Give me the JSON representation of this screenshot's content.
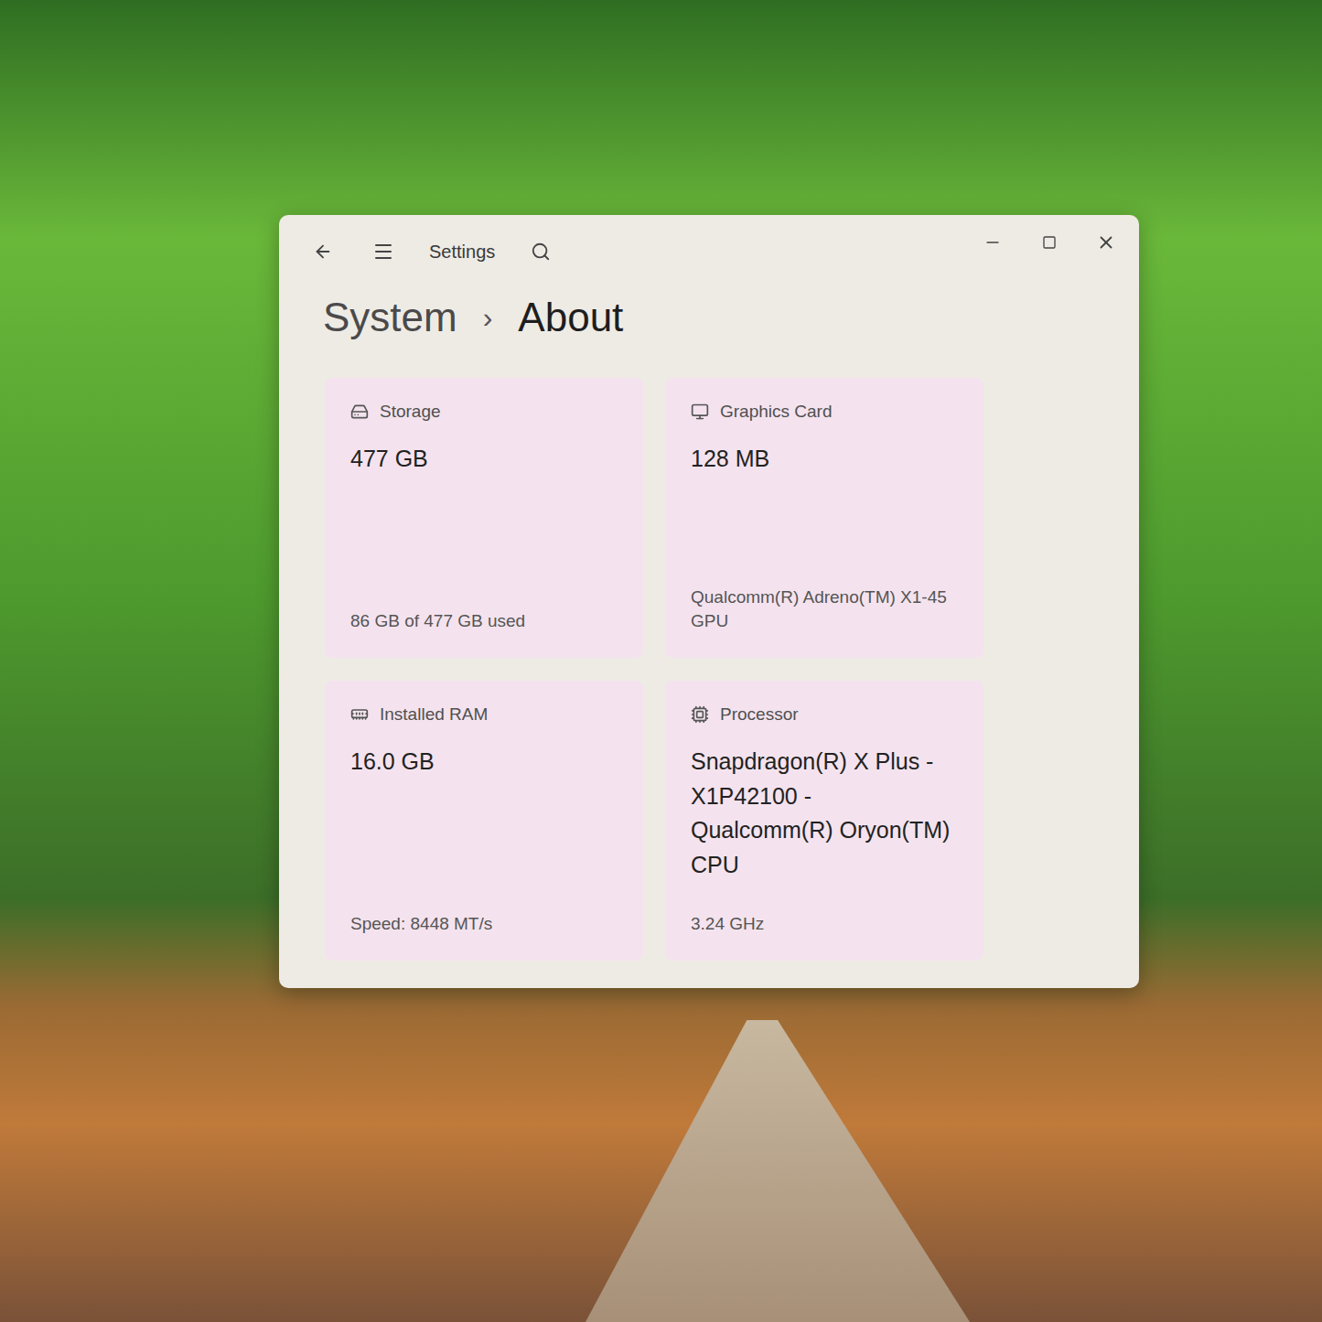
{
  "window": {
    "title": "Settings"
  },
  "breadcrumb": {
    "parent": "System",
    "separator": "›",
    "current": "About"
  },
  "cards": [
    {
      "label": "Storage",
      "value": "477 GB",
      "detail": "86 GB of 477 GB used"
    },
    {
      "label": "Graphics Card",
      "value": "128 MB",
      "detail": "Qualcomm(R) Adreno(TM) X1-45 GPU"
    },
    {
      "label": "Installed RAM",
      "value": "16.0 GB",
      "detail": "Speed: 8448 MT/s"
    },
    {
      "label": "Processor",
      "value": "Snapdragon(R) X Plus - X1P42100 - Qualcomm(R) Oryon(TM) CPU",
      "detail": "3.24 GHz"
    }
  ]
}
